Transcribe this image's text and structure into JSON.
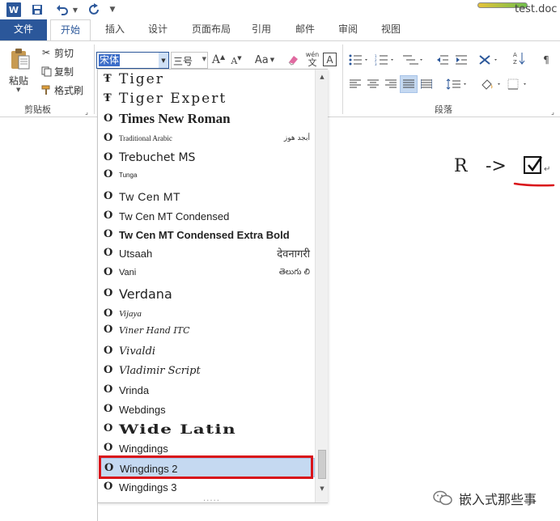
{
  "window": {
    "title": "test.doc",
    "logo_letter": "W"
  },
  "tabs": [
    {
      "label": "文件"
    },
    {
      "label": "开始"
    },
    {
      "label": "插入"
    },
    {
      "label": "设计"
    },
    {
      "label": "页面布局"
    },
    {
      "label": "引用"
    },
    {
      "label": "邮件"
    },
    {
      "label": "审阅"
    },
    {
      "label": "视图"
    }
  ],
  "clipboard": {
    "paste_label": "粘贴",
    "cut_label": "剪切",
    "copy_label": "复制",
    "format_painter_label": "格式刷",
    "group_label": "剪贴板"
  },
  "font": {
    "current_font": "宋体",
    "current_size": "三号",
    "change_case_label": "Aa",
    "pinyin_top": "wén",
    "pinyin_bottom": "文",
    "border_char": "A"
  },
  "paragraph": {
    "group_label": "段落"
  },
  "document": {
    "expression_left": "R",
    "expression_arrow": "->",
    "para_mark": "↵"
  },
  "font_list": {
    "items": [
      {
        "name": "Tiger",
        "icon": "truetype-icon",
        "sample": ""
      },
      {
        "name": "Tiger Expert",
        "icon": "truetype-icon",
        "sample": ""
      },
      {
        "name": "Times New Roman",
        "icon": "opentype-icon",
        "sample": ""
      },
      {
        "name": "Traditional Arabic",
        "icon": "opentype-icon",
        "sample": "أبجد هوز"
      },
      {
        "name": "Trebuchet MS",
        "icon": "opentype-icon",
        "sample": ""
      },
      {
        "name": "Tunga",
        "icon": "opentype-icon",
        "sample": ""
      },
      {
        "name": "Tw Cen MT",
        "icon": "opentype-icon",
        "sample": ""
      },
      {
        "name": "Tw Cen MT Condensed",
        "icon": "opentype-icon",
        "sample": ""
      },
      {
        "name": "Tw Cen MT Condensed Extra Bold",
        "icon": "opentype-icon",
        "sample": ""
      },
      {
        "name": "Utsaah",
        "icon": "opentype-icon",
        "sample": "देवनागरी"
      },
      {
        "name": "Vani",
        "icon": "opentype-icon",
        "sample": "తెలుగు లి"
      },
      {
        "name": "Verdana",
        "icon": "opentype-icon",
        "sample": ""
      },
      {
        "name": "Vijaya",
        "icon": "opentype-icon",
        "sample": ""
      },
      {
        "name": "Viner Hand ITC",
        "icon": "opentype-icon",
        "sample": ""
      },
      {
        "name": "Vivaldi",
        "icon": "opentype-icon",
        "sample": ""
      },
      {
        "name": "Vladimir Script",
        "icon": "opentype-icon",
        "sample": ""
      },
      {
        "name": "Vrinda",
        "icon": "opentype-icon",
        "sample": ""
      },
      {
        "name": "Webdings",
        "icon": "opentype-icon",
        "sample": ""
      },
      {
        "name": "Wide Latin",
        "icon": "opentype-icon",
        "sample": ""
      },
      {
        "name": "Wingdings",
        "icon": "opentype-icon",
        "sample": ""
      },
      {
        "name": "Wingdings 2",
        "icon": "opentype-icon",
        "sample": ""
      },
      {
        "name": "Wingdings 3",
        "icon": "opentype-icon",
        "sample": ""
      }
    ],
    "selected": "Wingdings 2",
    "grip": "....."
  },
  "watermark": {
    "text": "嵌入式那些事"
  },
  "colors": {
    "accent": "#2b579a",
    "highlight_border": "#d9141a",
    "selection": "#c5d9f1",
    "annotation_red": "#d9141a"
  }
}
